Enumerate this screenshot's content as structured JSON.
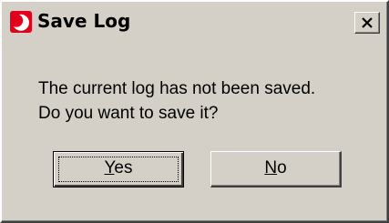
{
  "window": {
    "title": "Save Log",
    "icon": "app-logo-icon",
    "close_icon": "close-icon",
    "accent_color": "#e2001a",
    "face_color": "#d4d0c8"
  },
  "message": {
    "line1": "The current log has not been saved.",
    "line2": "Do you want to save it?"
  },
  "buttons": {
    "yes": {
      "mnemonic": "Y",
      "rest": "es",
      "label": "Yes"
    },
    "no": {
      "mnemonic": "N",
      "rest": "o",
      "label": "No"
    }
  }
}
